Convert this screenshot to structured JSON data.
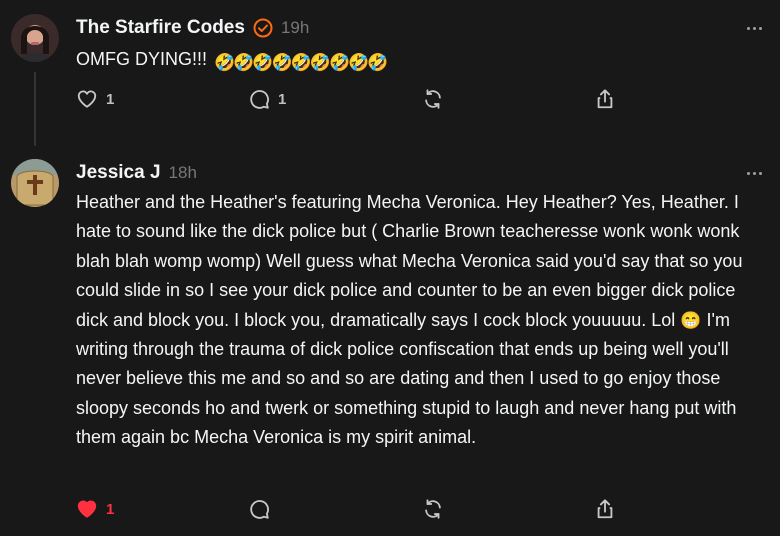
{
  "posts": [
    {
      "username": "The Starfire Codes",
      "verified": true,
      "time": "19h",
      "text": "OMFG DYING!!!",
      "emoji": "🤣🤣🤣🤣🤣🤣🤣🤣🤣",
      "likes": "1",
      "replies": "1",
      "liked": false,
      "icons": [
        "heart-icon",
        "comment-icon",
        "repost-icon",
        "share-icon"
      ]
    },
    {
      "username": "Jessica J",
      "verified": false,
      "time": "18h",
      "text_before_emoji": "Heather and the Heather's featuring Mecha Veronica. Hey Heather? Yes, Heather. I hate to sound like the dick police but ( Charlie Brown teacheresse wonk wonk wonk blah blah womp womp) Well guess what Mecha Veronica said you'd say that so you could slide in so I see your dick police and counter to be an even bigger dick police dick and block you. I block you, dramatically says I cock block youuuuu. Lol",
      "emoji": "😁",
      "text_after_emoji": " I'm writing through the trauma of dick police confiscation that ends up being well you'll never believe this me and so and so are dating and then I used to go enjoy those sloopy seconds ho and twerk or something stupid to laugh and never hang put with them again bc Mecha Veronica is my spirit animal.",
      "likes": "1",
      "liked": true,
      "like_color": "#ff3040",
      "icons": [
        "heart-icon",
        "comment-icon",
        "repost-icon",
        "share-icon"
      ]
    }
  ]
}
